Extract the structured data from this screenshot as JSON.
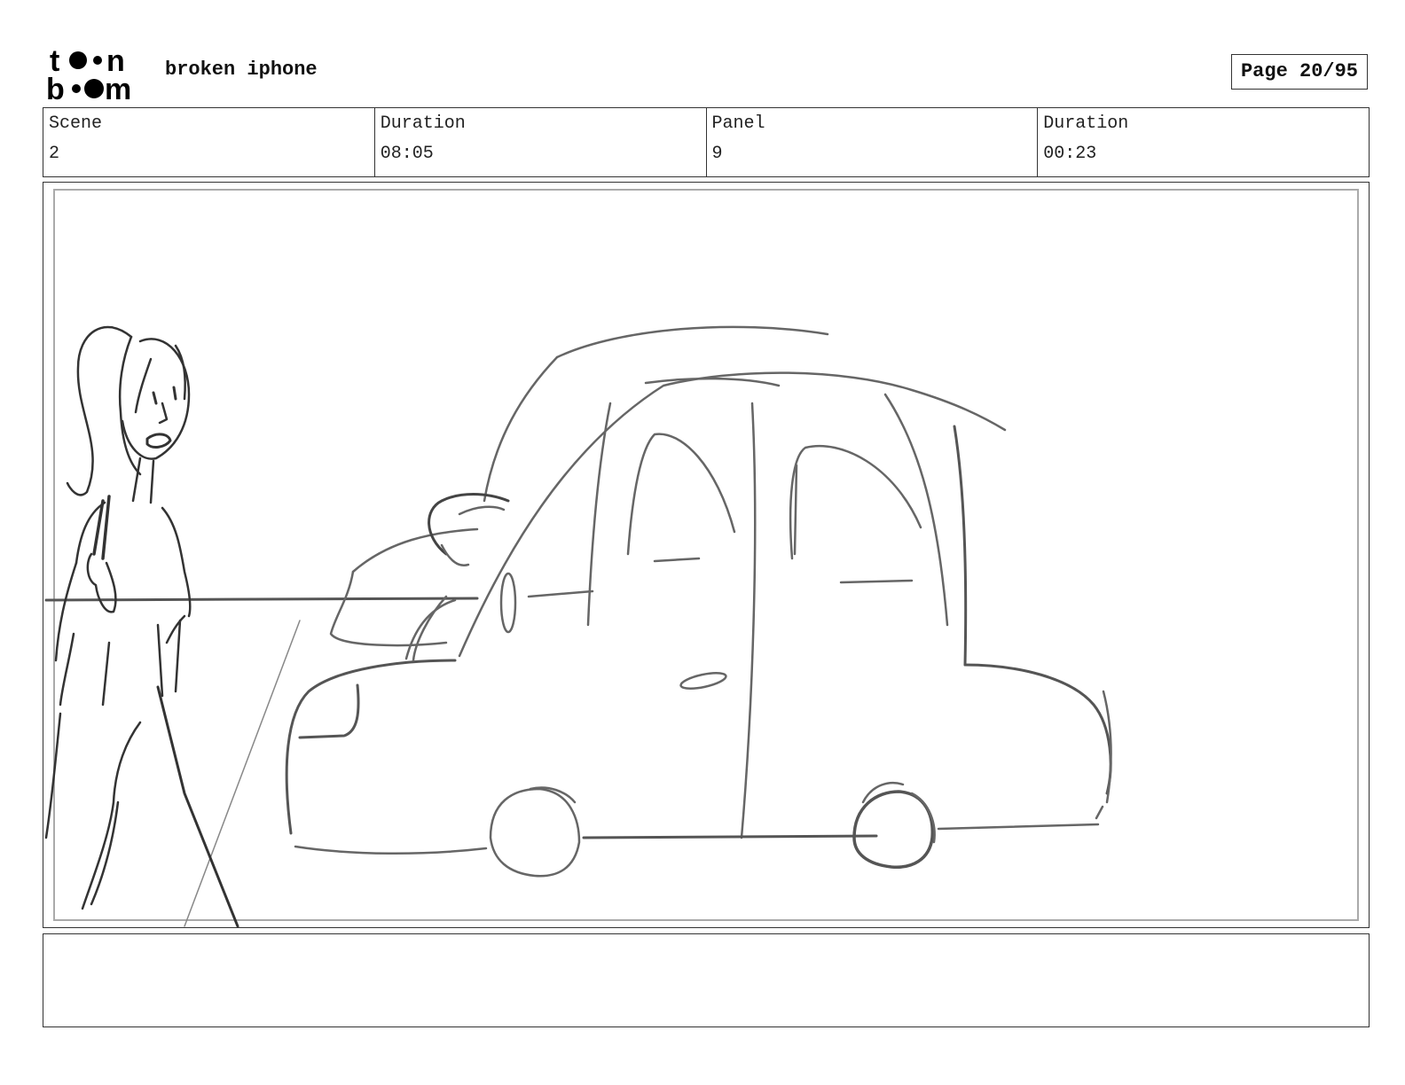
{
  "header": {
    "logo_text": "toonboom",
    "project_title": "broken iphone",
    "page_label": "Page 20/95"
  },
  "info": {
    "scene_label": "Scene",
    "scene_value": "2",
    "scene_duration_label": "Duration",
    "scene_duration_value": "08:05",
    "panel_label": "Panel",
    "panel_value": "9",
    "panel_duration_label": "Duration",
    "panel_duration_value": "00:23"
  },
  "notes": {
    "text": ""
  },
  "colors": {
    "border": "#333333",
    "sketch_dark": "#333333",
    "sketch_mid": "#666666"
  }
}
